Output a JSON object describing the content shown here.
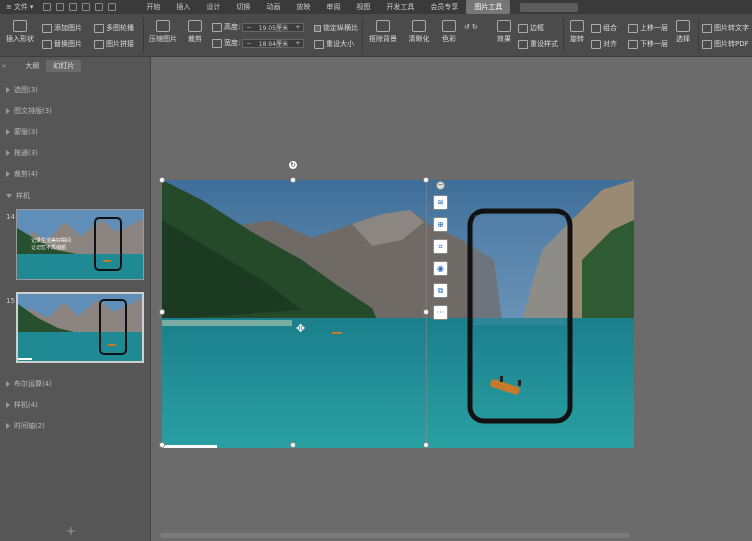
{
  "titlebar": {
    "file_label": "文件",
    "menus": [
      "开始",
      "插入",
      "设计",
      "切换",
      "动画",
      "放映",
      "审阅",
      "视图",
      "开发工具",
      "会员专享",
      "图片工具"
    ],
    "active_menu": "图片工具"
  },
  "ribbon": {
    "insert_shape": "插入形状",
    "add_picture": "添加图片",
    "replace_picture": "替换图片",
    "multi_picture": "多图轮播",
    "picture_collage": "图片拼接",
    "compress": "压缩图片",
    "crop": "裁剪",
    "height_label": "高度:",
    "height_value": "19.05厘米",
    "width_label": "宽度:",
    "width_value": "18.94厘米",
    "lock_ratio": "锁定纵横比",
    "reset_size": "重设大小",
    "remove_bg": "抠除背景",
    "sharpen": "清晰化",
    "color": "色彩",
    "effects": "效果",
    "reset_style": "重设样式",
    "border": "边框",
    "rotate": "旋转",
    "group": "组合",
    "align": "对齐",
    "bring_forward": "上移一层",
    "send_backward": "下移一层",
    "select": "选择",
    "img_to_text": "图片转文字",
    "img_to_pdf": "图片转PDF"
  },
  "panel": {
    "tab_outline": "大纲",
    "tab_slides": "幻灯片",
    "sections": [
      {
        "label": "选图(3)"
      },
      {
        "label": "图文排版(3)"
      },
      {
        "label": "蒙版(3)"
      },
      {
        "label": "拖通(3)"
      },
      {
        "label": "裁剪(4)"
      }
    ],
    "open_section": "样机",
    "slides": [
      {
        "num": "14",
        "caption_line1": "记录生活美好瞬间",
        "caption_line2": "让记忆不再褪颜"
      },
      {
        "num": "15"
      }
    ],
    "after_sections": [
      {
        "label": "布尔运算(4)"
      },
      {
        "label": "样机(4)"
      },
      {
        "label": "时间轴(2)"
      }
    ],
    "add_button": "+"
  },
  "colors": {
    "lake": "#1f8a93",
    "sky": "#4d7fa8",
    "mountain": "#6f6a66",
    "forest": "#244a2a",
    "boat": "#c77a2a"
  }
}
